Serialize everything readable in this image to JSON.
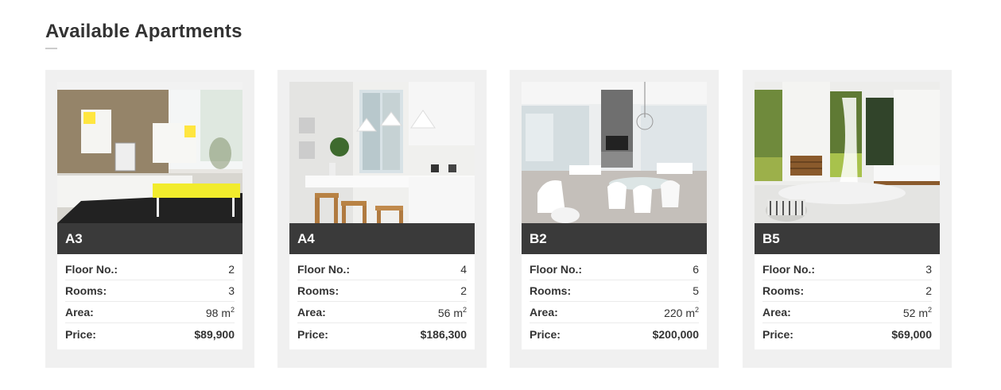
{
  "page": {
    "title": "Available Apartments"
  },
  "labels": {
    "floor": "Floor No.:",
    "rooms": "Rooms:",
    "area": "Area:",
    "price": "Price:",
    "area_unit": "m",
    "area_exp": "2"
  },
  "apartments": [
    {
      "name": "A3",
      "floor": "2",
      "rooms": "3",
      "area": "98",
      "price": "$89,900",
      "photo": "living-room-photo"
    },
    {
      "name": "A4",
      "floor": "4",
      "rooms": "2",
      "area": "56",
      "price": "$186,300",
      "photo": "kitchen-photo"
    },
    {
      "name": "B2",
      "floor": "6",
      "rooms": "5",
      "area": "220",
      "price": "$200,000",
      "photo": "dining-room-photo"
    },
    {
      "name": "B5",
      "floor": "3",
      "rooms": "2",
      "area": "52",
      "price": "$69,000",
      "photo": "bedroom-photo"
    }
  ]
}
